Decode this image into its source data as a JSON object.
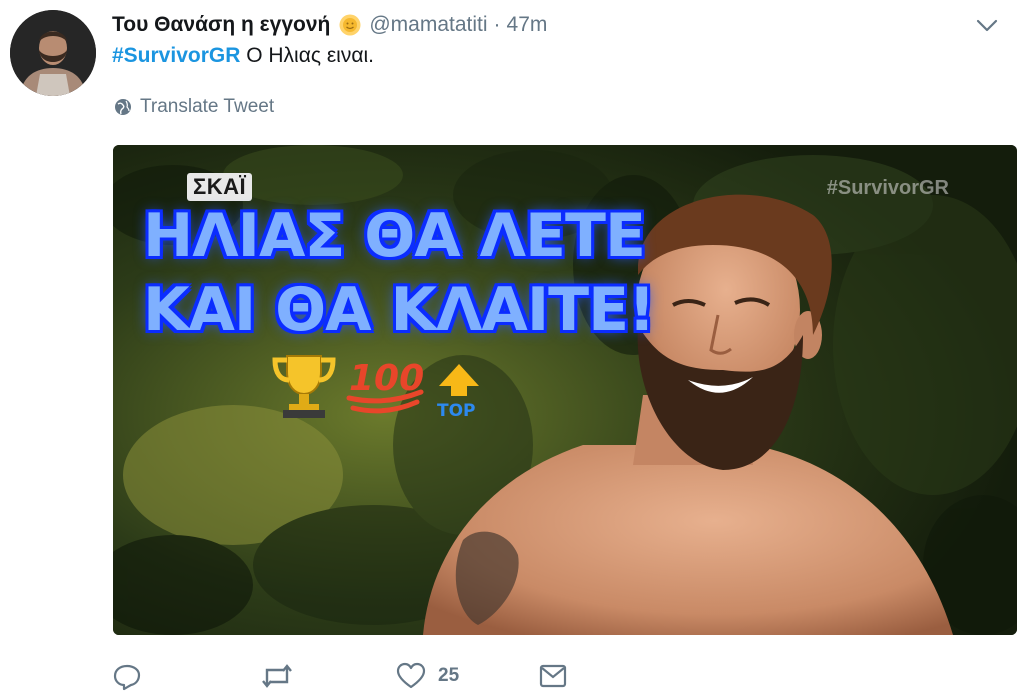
{
  "tweet": {
    "display_name": "Του Θανάση η εγγονή",
    "handle": "@mamatatiti",
    "separator": "·",
    "time": "47m",
    "hashtag": "#SurvivorGR",
    "text": " Ο Ηλιας ειναι.",
    "translate_label": "Translate Tweet"
  },
  "media": {
    "channel_logo": "ΣΚΑΪ",
    "watermark": "#SurvivorGR",
    "overlay_line1": "ΗΛΙΑΣ ΘΑ ΛΕΤΕ",
    "overlay_line2": "ΚΑΙ ΘΑ ΚΛΑΙΤΕ!",
    "emoji_hundred": "100",
    "emoji_top": "TOP"
  },
  "actions": {
    "like_count": "25"
  },
  "icons": [
    "sun-emoji-icon",
    "chevron-down-icon",
    "globe-icon",
    "trophy-icon",
    "hundred-points-icon",
    "top-arrow-icon",
    "reply-icon",
    "retweet-icon",
    "heart-icon",
    "message-icon"
  ],
  "colors": {
    "hashtag": "#1b95e0",
    "muted": "#657786",
    "overlay_text": "#7fb0ff",
    "overlay_outline": "#0b2cff"
  }
}
